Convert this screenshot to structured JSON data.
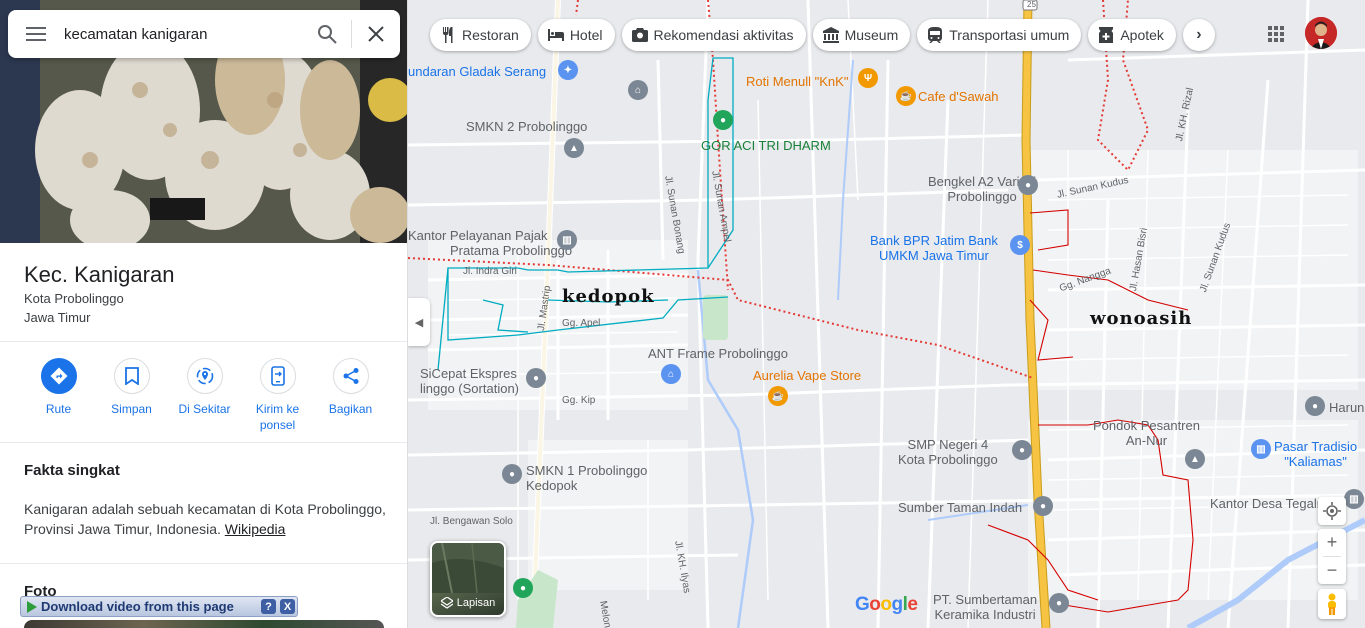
{
  "search": {
    "query": "kecamatan kanigaran"
  },
  "place": {
    "title": "Kec. Kanigaran",
    "line1": "Kota Probolinggo",
    "line2": "Jawa Timur"
  },
  "actions": [
    {
      "label": "Rute",
      "icon": "directions-icon"
    },
    {
      "label": "Simpan",
      "icon": "bookmark-icon"
    },
    {
      "label": "Di Sekitar",
      "icon": "nearby-icon"
    },
    {
      "label": "Kirim ke ponsel",
      "icon": "send-to-phone-icon"
    },
    {
      "label": "Bagikan",
      "icon": "share-icon"
    }
  ],
  "facts": {
    "title": "Fakta singkat",
    "text": "Kanigaran adalah sebuah kecamatan di Kota Probolinggo, Provinsi Jawa Timur, Indonesia.",
    "link": "Wikipedia"
  },
  "photos_title": "Foto",
  "download_bar": {
    "label": "Download video from this page",
    "help": "?",
    "close": "X"
  },
  "chips": [
    {
      "label": "Restoran",
      "icon": "restaurant-icon"
    },
    {
      "label": "Hotel",
      "icon": "hotel-icon"
    },
    {
      "label": "Rekomendasi aktivitas",
      "icon": "camera-icon"
    },
    {
      "label": "Museum",
      "icon": "museum-icon"
    },
    {
      "label": "Transportasi umum",
      "icon": "train-icon"
    },
    {
      "label": "Apotek",
      "icon": "pharmacy-icon"
    }
  ],
  "map": {
    "pois": {
      "alun": "undaran Gladak Serang",
      "roti": "Roti Menull \"KnK\"",
      "cafe": "Cafe d'Sawah",
      "smkn2": "SMKN 2 Probolinggo",
      "gor": "GOR ACI TRI DHARM",
      "bengkel1": "Bengkel A2 Variasi",
      "bengkel2": "Probolinggo",
      "pajak1": "Kantor Pelayanan Pajak",
      "pajak2": "Pratama Probolinggo",
      "bpr1": "Bank BPR Jatim Bank",
      "bpr2": "UMKM Jawa Timur",
      "ant": "ANT Frame Probolinggo",
      "aurelia": "Aurelia Vape Store",
      "sicepat1": "SiCepat Ekspres",
      "sicepat2": "linggo (Sortation)",
      "smkn1a": "SMKN 1 Probolinggo",
      "smkn1b": "Kedopok",
      "smpn4a": "SMP Negeri 4",
      "smpn4b": "Kota Probolinggo",
      "sumber": "Sumber Taman Indah",
      "pondok1": "Pondok Pesantren",
      "pondok2": "An-Nur",
      "pasar1": "Pasar Tradisio",
      "pasar2": "\"Kaliamas\"",
      "harun": "Harun",
      "kantor_desa": "Kantor Desa Tegalr",
      "pt1": "PT. Sumbertaman",
      "pt2": "Keramika Industri"
    },
    "streets": {
      "indragiri": "Jl. Indra Giri",
      "mastrip": "Jl. Mastrip",
      "apel": "Gg. Apel",
      "kip": "Gg. Kip",
      "bengawan": "Jl. Bengawan Solo",
      "ilyas": "Jl. KH. Ilyas",
      "meloni": "Melon",
      "sunan_bonang": "Jl. Sunan Bonang",
      "sunan_ampel": "Jl. Sunan Ampel",
      "sunan_kudus": "Jl. Sunan Kudus",
      "kh_rizal": "Jl. KH. Rizal",
      "hasan": "Jl. Hasan Bisri",
      "sunan_kudus2": "Jl. Sunan Kudus",
      "nangga": "Gg. Nangga",
      "route": "25"
    },
    "annotations": {
      "kedopok": "kedopok",
      "wonoasih": "wonoasih"
    },
    "layers_label": "Lapisan",
    "logo": [
      "G",
      "o",
      "o",
      "g",
      "l",
      "e"
    ]
  },
  "colors": {
    "accent": "#1a73e8",
    "boundary": "#e53935",
    "highway": "#f6c343",
    "water": "#aecbfa",
    "annotation_red": "#d50000",
    "annotation_cyan": "#0097a7"
  }
}
